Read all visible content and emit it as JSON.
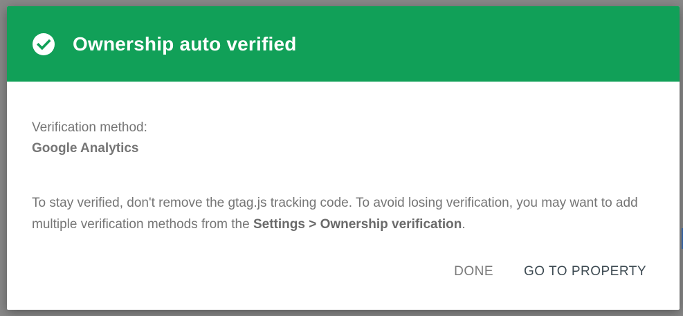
{
  "dialog": {
    "title": "Ownership auto verified",
    "header_color": "#11a058",
    "header_icon": "check-circle-icon",
    "method_label": "Verification method:",
    "method_value": "Google Analytics",
    "info_text_part1": "To stay verified, don't remove the gtag.js tracking code. To avoid losing verification, you may want to add multiple verification methods from the ",
    "info_text_bold": "Settings > Ownership verification",
    "info_text_part2": ".",
    "actions": {
      "done_label": "DONE",
      "go_label": "GO TO PROPERTY"
    }
  }
}
